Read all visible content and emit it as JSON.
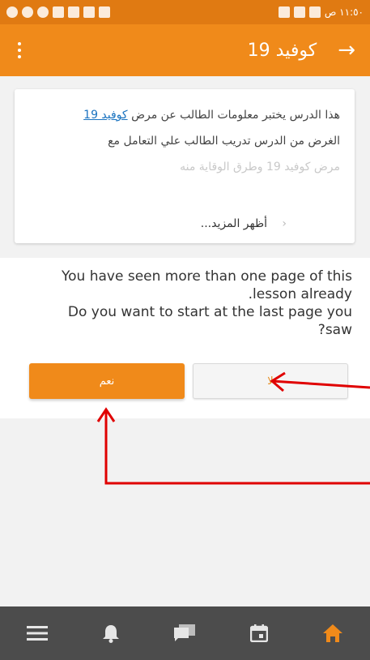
{
  "status_bar": {
    "time": "١١:٥٠ ص"
  },
  "app_bar": {
    "title": "كوفيد 19"
  },
  "card": {
    "line1_text": "هذا الدرس يختبر معلومات الطالب عن مرض",
    "line1_link": "كوفيد 19",
    "line2": "الغرض من الدرس تدريب الطالب علي التعامل مع",
    "line3_faded": "مرض كوفيد 19 وطرق الوقاية منه",
    "show_more": "أظهر المزيد..."
  },
  "prompt": {
    "line1": "You have seen more than one page of this",
    "line2": ".lesson already",
    "line3": "Do you want to start at the last page you",
    "line4": "?saw"
  },
  "buttons": {
    "no_label": "لا",
    "yes_label": "نعم"
  },
  "colors": {
    "accent": "#f08a1a",
    "annotation": "#e00000",
    "nav_bg": "#4c4c4c"
  },
  "nav": {
    "items": [
      "menu-icon",
      "bell-icon",
      "chat-icon",
      "calendar-icon",
      "home-icon"
    ],
    "active": "home-icon"
  }
}
